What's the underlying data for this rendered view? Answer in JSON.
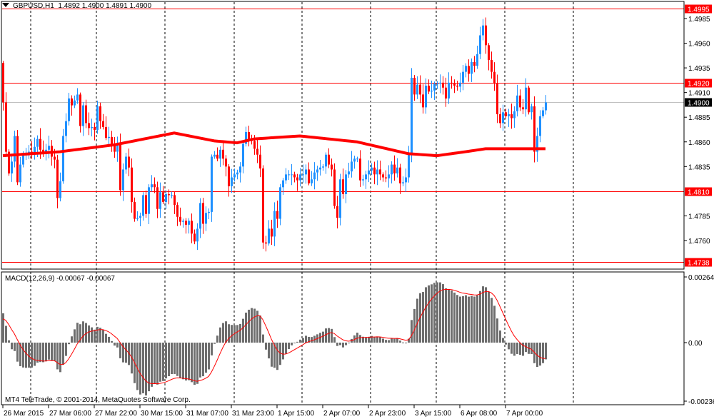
{
  "header": {
    "symbol": "GBPUSD,H1",
    "ohlc": "1.4892 1.4900 1.4891 1.4900",
    "menu_icon": "triangle-down-icon"
  },
  "macd_label": {
    "name": "MACD(12,26,9)",
    "main": "-0.00067",
    "signal": "-0.00067"
  },
  "copyright": "MT4 TeleTrade, © 2001-2014, MetaQuotes Software Corp.",
  "colors": {
    "bull": "#1e90ff",
    "bear": "#ff0000",
    "ma": "#ff0000",
    "level": "#ff0000",
    "bid": "#c0c0c0",
    "histogram": "#6e6e6e",
    "signal": "#ff0000"
  },
  "chart_data": [
    {
      "type": "candlestick",
      "title": "GBPUSD,H1",
      "ylim": [
        1.4738,
        1.4995
      ],
      "y_ticks": [
        "1.4985",
        "1.4960",
        "1.4935",
        "1.4910",
        "1.4885",
        "1.4860",
        "1.4835",
        "1.4785",
        "1.4760"
      ],
      "levels": [
        {
          "value": "1.4995",
          "kind": "resistance"
        },
        {
          "value": "1.4920",
          "kind": "resistance"
        },
        {
          "value": "1.4900",
          "kind": "bid"
        },
        {
          "value": "1.4810",
          "kind": "support"
        },
        {
          "value": "1.4738",
          "kind": "support"
        }
      ],
      "x_labels": [
        {
          "bar": 0,
          "text": "26 Mar 2015"
        },
        {
          "bar": 16,
          "text": "27 Mar 06:00"
        },
        {
          "bar": 32,
          "text": "27 Mar 22:00"
        },
        {
          "bar": 48,
          "text": "30 Mar 15:00"
        },
        {
          "bar": 64,
          "text": "31 Mar 07:00"
        },
        {
          "bar": 80,
          "text": "31 Mar 23:00"
        },
        {
          "bar": 96,
          "text": "1 Apr 15:00"
        },
        {
          "bar": 112,
          "text": "2 Apr 07:00"
        },
        {
          "bar": 128,
          "text": "2 Apr 23:00"
        },
        {
          "bar": 144,
          "text": "3 Apr 15:00"
        },
        {
          "bar": 160,
          "text": "6 Apr 08:00"
        },
        {
          "bar": 176,
          "text": "7 Apr 00:00"
        }
      ],
      "first_open": 1.494,
      "closes": [
        1.49,
        1.485,
        1.4828,
        1.484,
        1.4866,
        1.4819,
        1.4837,
        1.4847,
        1.4849,
        1.485,
        1.4848,
        1.4855,
        1.4863,
        1.4852,
        1.4848,
        1.4852,
        1.4856,
        1.4845,
        1.4842,
        1.4803,
        1.482,
        1.4866,
        1.4881,
        1.4904,
        1.4897,
        1.4902,
        1.4908,
        1.4876,
        1.4897,
        1.4879,
        1.4874,
        1.4875,
        1.4872,
        1.4896,
        1.4881,
        1.4875,
        1.4864,
        1.4865,
        1.4856,
        1.485,
        1.4858,
        1.4811,
        1.4832,
        1.4845,
        1.4834,
        1.4799,
        1.4782,
        1.4783,
        1.4785,
        1.4806,
        1.4787,
        1.4814,
        1.4817,
        1.4814,
        1.4792,
        1.4809,
        1.4799,
        1.4807,
        1.4806,
        1.4806,
        1.4796,
        1.4784,
        1.4779,
        1.478,
        1.4776,
        1.478,
        1.4767,
        1.4759,
        1.4772,
        1.4798,
        1.4777,
        1.4788,
        1.4789,
        1.4845,
        1.4847,
        1.4843,
        1.4852,
        1.4843,
        1.4835,
        1.4815,
        1.4824,
        1.4827,
        1.4829,
        1.4835,
        1.4858,
        1.487,
        1.4862,
        1.4861,
        1.4853,
        1.4847,
        1.4833,
        1.4758,
        1.4757,
        1.4772,
        1.4764,
        1.479,
        1.4782,
        1.4814,
        1.4821,
        1.4827,
        1.4827,
        1.4827,
        1.4824,
        1.4821,
        1.4827,
        1.4827,
        1.4832,
        1.4818,
        1.4822,
        1.4829,
        1.4832,
        1.4834,
        1.4835,
        1.4847,
        1.4837,
        1.4832,
        1.4795,
        1.4783,
        1.4822,
        1.4807,
        1.4827,
        1.483,
        1.484,
        1.4843,
        1.4843,
        1.4821,
        1.4822,
        1.4827,
        1.4831,
        1.4834,
        1.4827,
        1.4832,
        1.4827,
        1.4824,
        1.4823,
        1.4827,
        1.4837,
        1.4828,
        1.4834,
        1.4818,
        1.4819,
        1.4824,
        1.4847,
        1.4925,
        1.4908,
        1.4918,
        1.4908,
        1.4895,
        1.4917,
        1.4911,
        1.4912,
        1.4919,
        1.4919,
        1.492,
        1.4915,
        1.4904,
        1.492,
        1.4919,
        1.4917,
        1.4916,
        1.492,
        1.4931,
        1.4937,
        1.4929,
        1.4941,
        1.4937,
        1.4949,
        1.4968,
        1.4978,
        1.4958,
        1.4943,
        1.4931,
        1.4919,
        1.4888,
        1.4879,
        1.489,
        1.4886,
        1.4888,
        1.4884,
        1.4891,
        1.4907,
        1.4895,
        1.4893,
        1.4915,
        1.489,
        1.4896,
        1.485,
        1.4866,
        1.4886,
        1.4892,
        1.49
      ],
      "moving_average": [
        {
          "bar": 0,
          "value": 1.4846
        },
        {
          "bar": 20,
          "value": 1.485
        },
        {
          "bar": 39,
          "value": 1.4857
        },
        {
          "bar": 60,
          "value": 1.4869
        },
        {
          "bar": 74,
          "value": 1.4861
        },
        {
          "bar": 82,
          "value": 1.4859
        },
        {
          "bar": 88,
          "value": 1.4863
        },
        {
          "bar": 104,
          "value": 1.4866
        },
        {
          "bar": 124,
          "value": 1.486
        },
        {
          "bar": 142,
          "value": 1.4848
        },
        {
          "bar": 152,
          "value": 1.4846
        },
        {
          "bar": 162,
          "value": 1.485
        },
        {
          "bar": 169,
          "value": 1.4853
        },
        {
          "bar": 190,
          "value": 1.4853
        }
      ]
    },
    {
      "type": "bar",
      "title": "MACD(12,26,9)",
      "params": [
        12,
        26,
        9
      ],
      "ylim": [
        -0.00236,
        0.00264
      ],
      "y_ticks": [
        "0.00264",
        "0.00",
        "-0.00236"
      ],
      "seed": {
        "ema_fast": 1.4903,
        "ema_slow": 1.489,
        "signal": 0.0009
      }
    }
  ]
}
